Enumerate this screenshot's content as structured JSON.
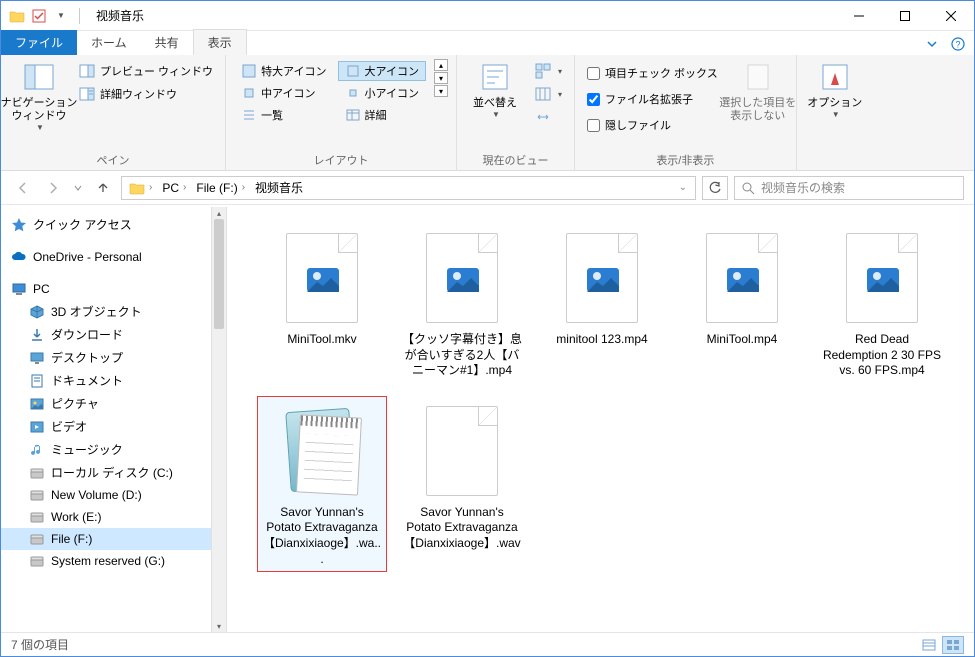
{
  "window": {
    "title": "视频音乐"
  },
  "tabs": {
    "file": "ファイル",
    "home": "ホーム",
    "share": "共有",
    "view": "表示"
  },
  "ribbon": {
    "panes": {
      "label": "ペイン",
      "nav": "ナビゲーション\nウィンドウ",
      "preview": "プレビュー ウィンドウ",
      "details": "詳細ウィンドウ"
    },
    "layout": {
      "label": "レイアウト",
      "xl": "特大アイコン",
      "l": "大アイコン",
      "m": "中アイコン",
      "s": "小アイコン",
      "list": "一覧",
      "det": "詳細"
    },
    "current": {
      "label": "現在のビュー",
      "sort": "並べ替え"
    },
    "show": {
      "label": "表示/非表示",
      "itemcheck": "項目チェック ボックス",
      "ext": "ファイル名拡張子",
      "hidden": "隠しファイル",
      "hidesel": "選択した項目を\n表示しない"
    },
    "options": {
      "label": "オプション"
    }
  },
  "breadcrumb": {
    "pc": "PC",
    "drive": "File (F:)",
    "folder": "视频音乐"
  },
  "search": {
    "placeholder": "视频音乐の検索"
  },
  "sidebar": {
    "quick": "クイック アクセス",
    "onedrive": "OneDrive - Personal",
    "pc": "PC",
    "items": [
      "3D オブジェクト",
      "ダウンロード",
      "デスクトップ",
      "ドキュメント",
      "ピクチャ",
      "ビデオ",
      "ミュージック",
      "ローカル ディスク (C:)",
      "New Volume (D:)",
      "Work (E:)",
      "File (F:)",
      "System reserved (G:)"
    ]
  },
  "files": [
    {
      "name": "MiniTool.mkv",
      "type": "video",
      "selected": false
    },
    {
      "name": "【クッソ字幕付き】息が合いすぎる2人【バニーマン#1】.mp4",
      "type": "video",
      "selected": false
    },
    {
      "name": "minitool 123.mp4",
      "type": "video",
      "selected": false
    },
    {
      "name": "MiniTool.mp4",
      "type": "video",
      "selected": false
    },
    {
      "name": "Red Dead Redemption 2 30 FPS vs. 60 FPS.mp4",
      "type": "video",
      "selected": false
    },
    {
      "name": "Savor Yunnan's Potato Extravaganza【Dianxixiaoge】.wa...",
      "type": "notepad",
      "selected": true
    },
    {
      "name": "Savor Yunnan's Potato Extravaganza【Dianxixiaoge】.wav",
      "type": "blank",
      "selected": false
    }
  ],
  "status": {
    "count": "7 個の項目"
  }
}
